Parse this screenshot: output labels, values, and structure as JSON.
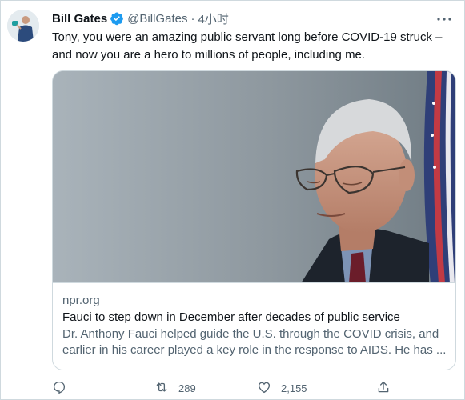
{
  "tweet": {
    "author_name": "Bill Gates",
    "handle": "@BillGates",
    "separator": "·",
    "time": "4小时",
    "text": "Tony, you were an amazing public servant long before COVID-19 struck – and now you are a hero to millions of people, including me."
  },
  "card": {
    "domain": "npr.org",
    "title": "Fauci to step down in December after decades of public service",
    "description": "Dr. Anthony Fauci helped guide the U.S. through the COVID crisis, and earlier in his career played a key role in the response to AIDS. He has ..."
  },
  "actions": {
    "reply_icon": "reply-icon",
    "retweet_icon": "retweet-icon",
    "retweet_count": "289",
    "like_icon": "like-icon",
    "like_count": "2,155",
    "share_icon": "share-icon"
  },
  "colors": {
    "verified_blue": "#1d9bf0",
    "secondary_text": "#536471",
    "border": "#cfd9de"
  }
}
